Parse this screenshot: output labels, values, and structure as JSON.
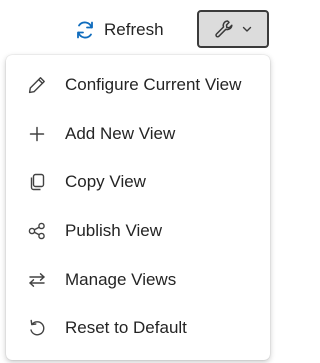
{
  "toolbar": {
    "refresh_label": "Refresh",
    "refresh_icon": "refresh-icon",
    "tools_icon": "wrench-icon",
    "tools_chevron": "chevron-down-icon",
    "accent_color": "#0f6cbd",
    "tools_bg": "#dcdcdc"
  },
  "menu": {
    "items": [
      {
        "label": "Configure Current View",
        "icon": "pencil-icon"
      },
      {
        "label": "Add New View",
        "icon": "plus-icon"
      },
      {
        "label": "Copy View",
        "icon": "copy-icon"
      },
      {
        "label": "Publish View",
        "icon": "share-icon"
      },
      {
        "label": "Manage Views",
        "icon": "arrows-swap-icon"
      },
      {
        "label": "Reset to Default",
        "icon": "undo-icon"
      }
    ]
  }
}
